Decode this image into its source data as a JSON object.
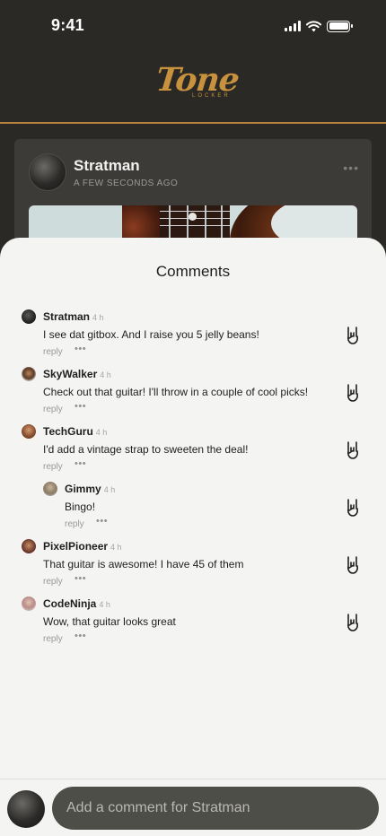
{
  "status_bar": {
    "time": "9:41"
  },
  "header": {
    "logo_text": "Tone",
    "logo_subtext": "LOCKER"
  },
  "post": {
    "author": "Stratman",
    "timestamp": "A FEW SECONDS AGO",
    "menu_icon": "more-dots-icon"
  },
  "comments_sheet": {
    "title": "Comments",
    "reply_label": "reply",
    "more_label": "•••",
    "like_icon": "rock-hand-icon",
    "comments": [
      {
        "author": "Stratman",
        "time": "4 h",
        "text": "I see dat gitbox. And I raise you 5 jelly beans!"
      },
      {
        "author": "SkyWalker",
        "time": "4 h",
        "text": "Check out that guitar! I'll throw in a couple of cool picks!"
      },
      {
        "author": "TechGuru",
        "time": "4 h",
        "text": "I'd add a vintage strap to sweeten the deal!"
      },
      {
        "author": "Gimmy",
        "time": "4 h",
        "text": "Bingo!"
      },
      {
        "author": "PixelPioneer",
        "time": "4 h",
        "text": "That guitar is awesome! I have 45 of them"
      },
      {
        "author": "CodeNinja",
        "time": "4 h",
        "text": "Wow, that guitar looks great"
      }
    ]
  },
  "composer": {
    "placeholder": "Add a comment for Stratman"
  }
}
